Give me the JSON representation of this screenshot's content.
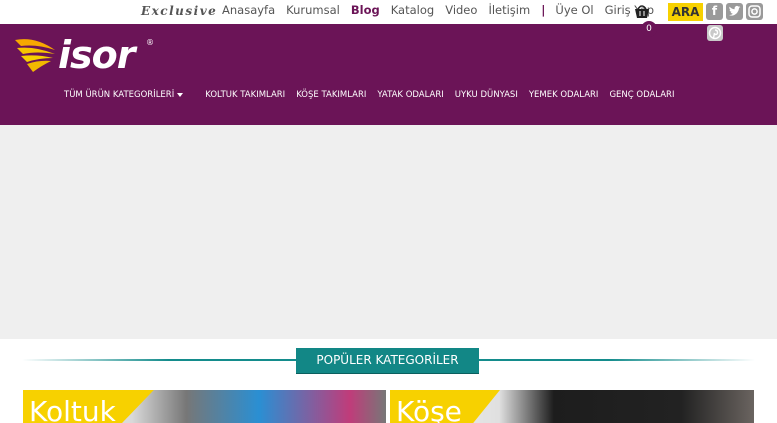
{
  "topbar": {
    "tagline": "Exclusive",
    "links": [
      "Anasayfa",
      "Kurumsal",
      "Blog",
      "Katalog",
      "Video",
      "İletişim"
    ],
    "separator": "|",
    "register": "Üye Ol",
    "login": "Giriş Yap",
    "cart_count": "0",
    "search_label": "ARA",
    "social": [
      "facebook",
      "twitter",
      "instagram",
      "pinterest"
    ]
  },
  "brand": {
    "logo_text": "isor",
    "registered": "®"
  },
  "nav": {
    "items": [
      "TÜM ÜRÜN KATEGORİLERİ",
      "KOLTUK TAKIMLARI",
      "KÖŞE TAKIMLARI",
      "YATAK ODALARI",
      "UYKU DÜNYASI",
      "YEMEK ODALARI",
      "GENÇ ODALARI"
    ]
  },
  "popular": {
    "title": "POPÜLER KATEGORİLER",
    "tiles": [
      "Koltuk",
      "Köşe"
    ]
  },
  "colors": {
    "brand_purple": "#6b1457",
    "accent_yellow": "#f7d100",
    "teal": "#128786"
  }
}
